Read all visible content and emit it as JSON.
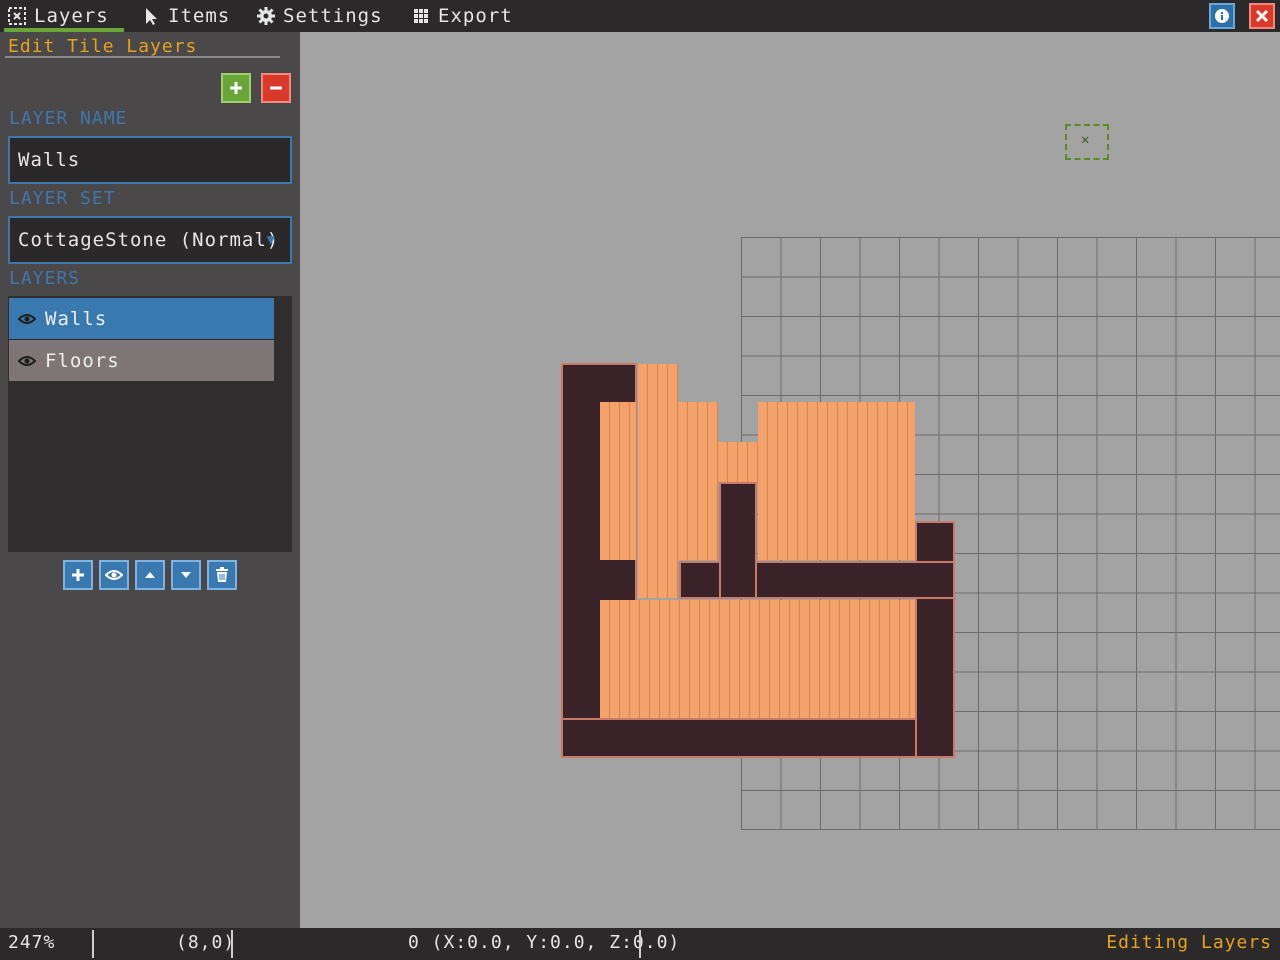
{
  "menubar": {
    "items": [
      {
        "label": "Layers",
        "icon": "layers-icon"
      },
      {
        "label": "Items",
        "icon": "cursor-icon"
      },
      {
        "label": "Settings",
        "icon": "gear-icon"
      },
      {
        "label": "Export",
        "icon": "grid-icon"
      }
    ],
    "active_accent": "#6aa53a"
  },
  "sidebar": {
    "title": "Edit Tile Layers",
    "layer_name_label": "LAYER NAME",
    "layer_name_value": "Walls",
    "layer_set_label": "LAYER SET",
    "layer_set_value": "CottageStone (Normal)",
    "layers_label": "LAYERS",
    "layers": [
      {
        "name": "Walls",
        "selected": true
      },
      {
        "name": "Floors",
        "selected": false
      }
    ]
  },
  "status": {
    "zoom": "247%",
    "tile_coord": "(8,0)",
    "world_coord": "0 (X:0.0, Y:0.0, Z:0.0)",
    "mode": "Editing Layers"
  },
  "colors": {
    "accent_orange": "#e8a21f",
    "accent_blue": "#3a79b0",
    "add_green": "#6aa53a",
    "remove_red": "#d8392b"
  }
}
